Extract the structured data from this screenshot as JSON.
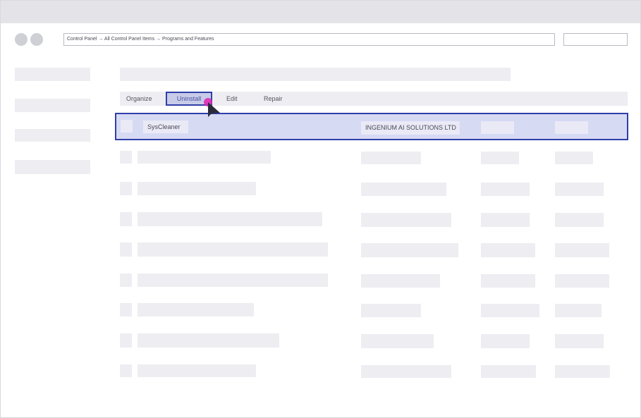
{
  "address_bar": {
    "path": "Control Panel → All Control Panel Items → Programs and Features"
  },
  "toolbar": {
    "organize_label": "Organize",
    "uninstall_label": "Uninstall",
    "edit_label": "Edit",
    "repair_label": "Repair"
  },
  "selected_row": {
    "name": "SysCleaner",
    "publisher": "INGENIUM AI SOLUTIONS LTD"
  },
  "colors": {
    "accent": "#2f3fa8",
    "selection_fill": "#d7daf3",
    "cursor_dot": "#e020b0",
    "placeholder": "#ededf2"
  }
}
